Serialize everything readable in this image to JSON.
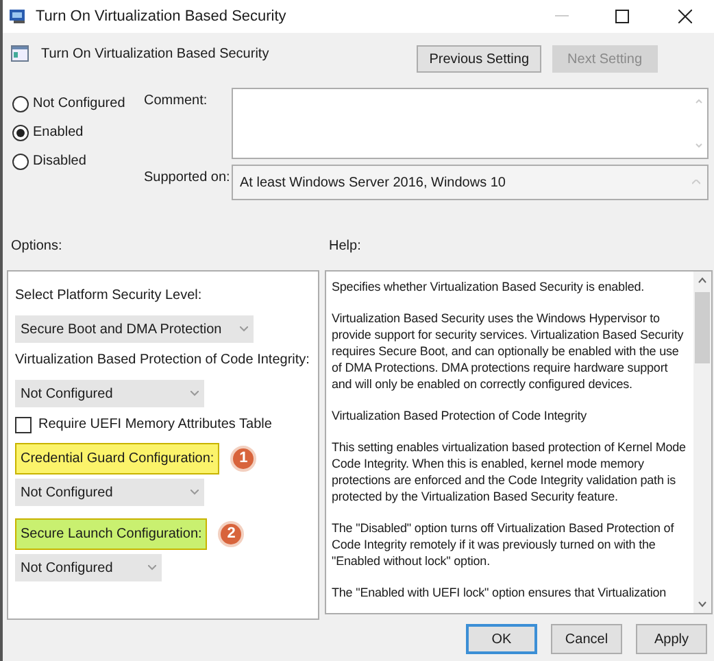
{
  "window": {
    "title": "Turn On Virtualization Based Security"
  },
  "header": {
    "title": "Turn On Virtualization Based Security",
    "buttons": [
      {
        "label": "Previous Setting",
        "disabled": false
      },
      {
        "label": "Next Setting",
        "disabled": true
      }
    ]
  },
  "state_options": [
    {
      "label": "Not Configured",
      "selected": false
    },
    {
      "label": "Enabled",
      "selected": true
    },
    {
      "label": "Disabled",
      "selected": false
    }
  ],
  "comment": {
    "label": "Comment:"
  },
  "supported_on": {
    "label": "Supported on:",
    "value": "At least Windows Server 2016, Windows 10"
  },
  "options": {
    "label": "Options:",
    "items": [
      {
        "kind": "label",
        "text": "Select Platform Security Level:"
      },
      {
        "kind": "dropdown",
        "value": "Secure Boot and DMA Protection"
      },
      {
        "kind": "label",
        "text": "Virtualization Based Protection of Code Integrity:"
      },
      {
        "kind": "dropdown",
        "value": "Not Configured"
      },
      {
        "kind": "checkbox",
        "text": "Require UEFI Memory Attributes Table",
        "checked": false
      },
      {
        "kind": "label",
        "text": "Credential Guard Configuration:",
        "color": "#fbf36a",
        "badge": "1"
      },
      {
        "kind": "dropdown",
        "value": "Not Configured"
      },
      {
        "kind": "label",
        "text": "Secure Launch Configuration:",
        "color": "#c9f070",
        "badge": "2"
      },
      {
        "kind": "dropdown",
        "value": "Not Configured"
      }
    ]
  },
  "help": {
    "label": "Help:",
    "paragraphs": [
      "Specifies whether Virtualization Based Security is enabled.",
      "Virtualization Based Security uses the Windows Hypervisor to provide support for security services. Virtualization Based Security requires Secure Boot, and can optionally be enabled with the use of DMA Protections. DMA protections require hardware support and will only be enabled on correctly configured devices.",
      "Virtualization Based Protection of Code Integrity",
      "This setting enables virtualization based protection of Kernel Mode Code Integrity. When this is enabled, kernel mode memory protections are enforced and the Code Integrity validation path is protected by the Virtualization Based Security feature.",
      "The \"Disabled\" option turns off Virtualization Based Protection of Code Integrity remotely if it was previously turned on with the \"Enabled without lock\" option.",
      "The \"Enabled with UEFI lock\" option ensures that Virtualization"
    ]
  },
  "footer_buttons": [
    {
      "label": "OK",
      "default": true
    },
    {
      "label": "Cancel",
      "default": false
    },
    {
      "label": "Apply",
      "default": false
    }
  ]
}
